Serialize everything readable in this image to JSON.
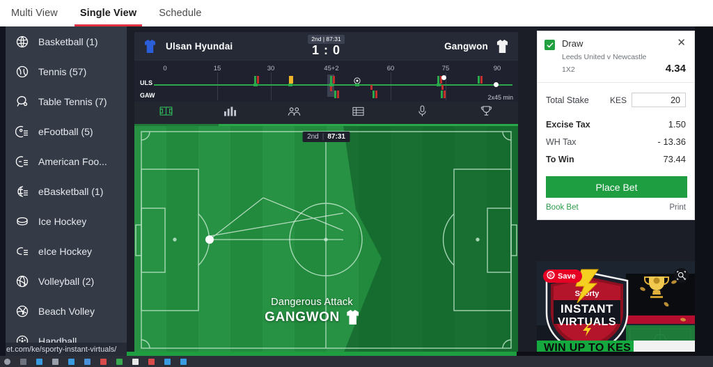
{
  "browser": {
    "tabs": [
      {
        "label": "Multi View",
        "active": false
      },
      {
        "label": "Single View",
        "active": true
      },
      {
        "label": "Schedule",
        "active": false
      }
    ],
    "status_url": "et.com/ke/sporty-instant-virtuals/"
  },
  "sidebar": {
    "items": [
      {
        "label": "Basketball (1)",
        "icon": "basketball-icon"
      },
      {
        "label": "Tennis (57)",
        "icon": "tennis-icon"
      },
      {
        "label": "Table Tennis (7)",
        "icon": "table-tennis-icon"
      },
      {
        "label": "eFootball (5)",
        "icon": "efootball-icon"
      },
      {
        "label": "American Foo...",
        "icon": "american-football-icon"
      },
      {
        "label": "eBasketball (1)",
        "icon": "ebasketball-icon"
      },
      {
        "label": "Ice Hockey",
        "icon": "ice-hockey-icon"
      },
      {
        "label": "eIce Hockey",
        "icon": "eice-hockey-icon"
      },
      {
        "label": "Volleyball (2)",
        "icon": "volleyball-icon"
      },
      {
        "label": "Beach Volley",
        "icon": "beach-volley-icon"
      },
      {
        "label": "Handball",
        "icon": "handball-icon"
      }
    ]
  },
  "match": {
    "home_team": "Ulsan Hyundai",
    "away_team": "Gangwon",
    "period": "2nd | 87:31",
    "score": "1 : 0",
    "home_abbr": "ULS",
    "away_abbr": "GAW",
    "duration_note": "2x45 min",
    "timeline_ticks": [
      "0",
      "15",
      "30",
      "45+2",
      "60",
      "75",
      "90"
    ],
    "icon_tabs": [
      {
        "name": "pitch-tab",
        "active": true
      },
      {
        "name": "statistics-tab",
        "active": false
      },
      {
        "name": "lineups-tab",
        "active": false
      },
      {
        "name": "table-tab",
        "active": false
      },
      {
        "name": "commentary-tab",
        "active": false
      },
      {
        "name": "trophy-tab",
        "active": false
      }
    ],
    "pitch_period": "2nd",
    "pitch_clock": "87:31",
    "attack_status": "Dangerous Attack",
    "attack_team": "GANGWON"
  },
  "betslip": {
    "selection": "Draw",
    "event": "Leeds United v Newcastle",
    "market": "1X2",
    "odds": "4.34",
    "stake_label": "Total Stake",
    "currency": "KES",
    "stake_value": "20",
    "rows": [
      {
        "label": "Excise Tax",
        "value": "1.50",
        "bold": true
      },
      {
        "label": "WH Tax",
        "value": "- 13.36",
        "bold": false
      },
      {
        "label": "To Win",
        "value": "73.44",
        "bold": true
      }
    ],
    "place_bet": "Place Bet",
    "book_bet": "Book Bet",
    "print": "Print"
  },
  "promo": {
    "save_label": "Save",
    "brand": "Sporty",
    "line1": "INSTANT",
    "line2": "VIRTUALS",
    "tagline": "WIN UP TO KES"
  },
  "colors": {
    "accent_red": "#e23241",
    "green": "#1e9e41",
    "pitch": "#218a3c",
    "sidebar_bg": "#343a46",
    "panel_bg": "#1f222e"
  }
}
